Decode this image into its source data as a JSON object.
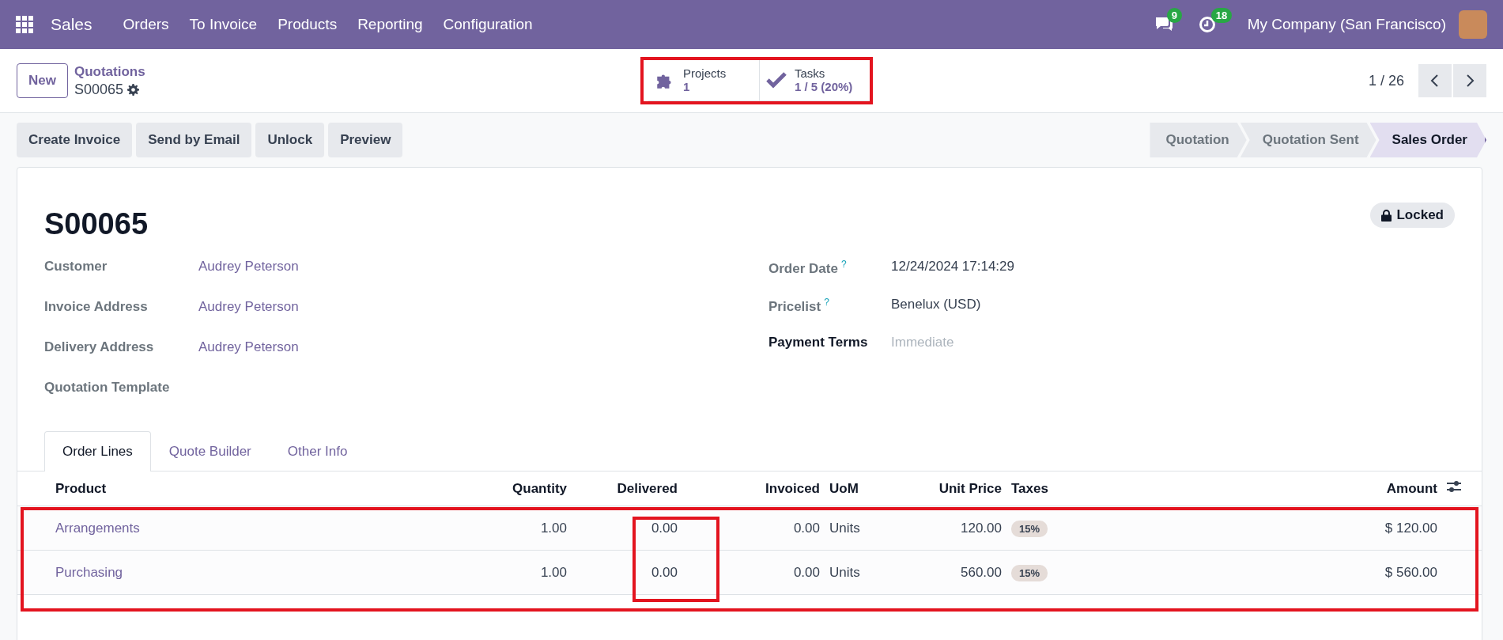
{
  "navbar": {
    "app_name": "Sales",
    "menu": [
      "Orders",
      "To Invoice",
      "Products",
      "Reporting",
      "Configuration"
    ],
    "messages_count": "9",
    "activities_count": "18",
    "company": "My Company (San Francisco)"
  },
  "control_panel": {
    "new_button": "New",
    "breadcrumb": "Quotations",
    "record": "S00065",
    "stat_buttons": [
      {
        "kind": "puzzle",
        "label": "Projects",
        "value": "1"
      },
      {
        "kind": "check",
        "label": "Tasks",
        "value": "1 / 5 (20%)"
      }
    ],
    "pager": "1 / 26"
  },
  "actions": [
    "Create Invoice",
    "Send by Email",
    "Unlock",
    "Preview"
  ],
  "stages": [
    {
      "label": "Quotation",
      "selected": false
    },
    {
      "label": "Quotation Sent",
      "selected": false
    },
    {
      "label": "Sales Order",
      "selected": true
    }
  ],
  "sheet": {
    "title": "S00065",
    "badge": "Locked",
    "left_fields": [
      {
        "label": "Customer",
        "value": "Audrey Peterson"
      },
      {
        "label": "Invoice Address",
        "value": "Audrey Peterson"
      },
      {
        "label": "Delivery Address",
        "value": "Audrey Peterson"
      },
      {
        "label": "Quotation Template"
      }
    ],
    "right_fields": [
      {
        "label": "Order Date",
        "help": "?",
        "value": "12/24/2024 17:14:29",
        "required": false
      },
      {
        "label": "Pricelist",
        "help": "?",
        "value": "Benelux (USD)",
        "required": false
      },
      {
        "label": "Payment Terms",
        "placeholder": "Immediate",
        "required": true
      }
    ],
    "tabs": [
      {
        "label": "Order Lines",
        "selected": true
      },
      {
        "label": "Quote Builder",
        "selected": false
      },
      {
        "label": "Other Info",
        "selected": false
      }
    ],
    "table": {
      "columns": [
        "Product",
        "Quantity",
        "Delivered",
        "Invoiced",
        "UoM",
        "Unit Price",
        "Taxes",
        "Amount"
      ],
      "rows": [
        {
          "product": "Arrangements",
          "quantity": "1.00",
          "delivered": "0.00",
          "invoiced": "0.00",
          "uom": "Units",
          "unit_price": "120.00",
          "taxes": [
            "15%"
          ],
          "amount": "$ 120.00"
        },
        {
          "product": "Purchasing",
          "quantity": "1.00",
          "delivered": "0.00",
          "invoiced": "0.00",
          "uom": "Units",
          "unit_price": "560.00",
          "taxes": [
            "15%"
          ],
          "amount": "$ 560.00"
        }
      ]
    }
  }
}
